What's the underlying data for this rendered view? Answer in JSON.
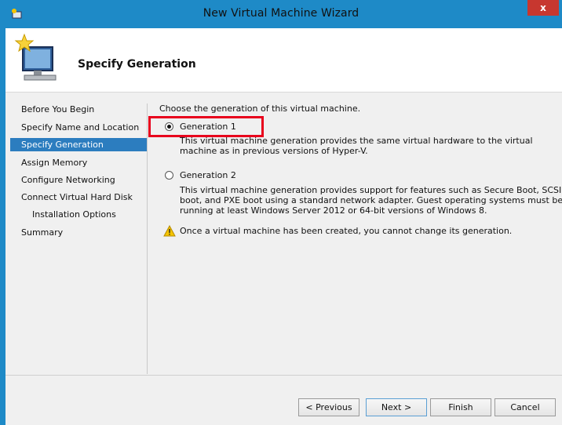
{
  "window": {
    "title": "New Virtual Machine Wizard",
    "close_label": "x"
  },
  "header": {
    "title": "Specify Generation"
  },
  "steps": [
    {
      "label": "Before You Begin"
    },
    {
      "label": "Specify Name and Location"
    },
    {
      "label": "Specify Generation",
      "active": true
    },
    {
      "label": "Assign Memory"
    },
    {
      "label": "Configure Networking"
    },
    {
      "label": "Connect Virtual Hard Disk"
    },
    {
      "label": "Installation Options",
      "sub": true
    },
    {
      "label": "Summary"
    }
  ],
  "content": {
    "prompt": "Choose the generation of this virtual machine.",
    "options": [
      {
        "label": "Generation 1",
        "selected": true,
        "description": "This virtual machine generation provides the same virtual hardware to the virtual machine as in previous versions of Hyper-V."
      },
      {
        "label": "Generation 2",
        "selected": false,
        "description": "This virtual machine generation provides support for features such as Secure Boot, SCSI boot, and PXE boot using a standard network adapter. Guest operating systems must be running at least Windows Server 2012 or 64-bit versions of Windows 8."
      }
    ],
    "warning": "Once a virtual machine has been created, you cannot change its generation."
  },
  "buttons": {
    "previous": "< Previous",
    "next": "Next >",
    "finish": "Finish",
    "cancel": "Cancel"
  },
  "colors": {
    "accent": "#1e8ac7",
    "selection": "#2c7dbf",
    "highlight": "#e8001c"
  }
}
